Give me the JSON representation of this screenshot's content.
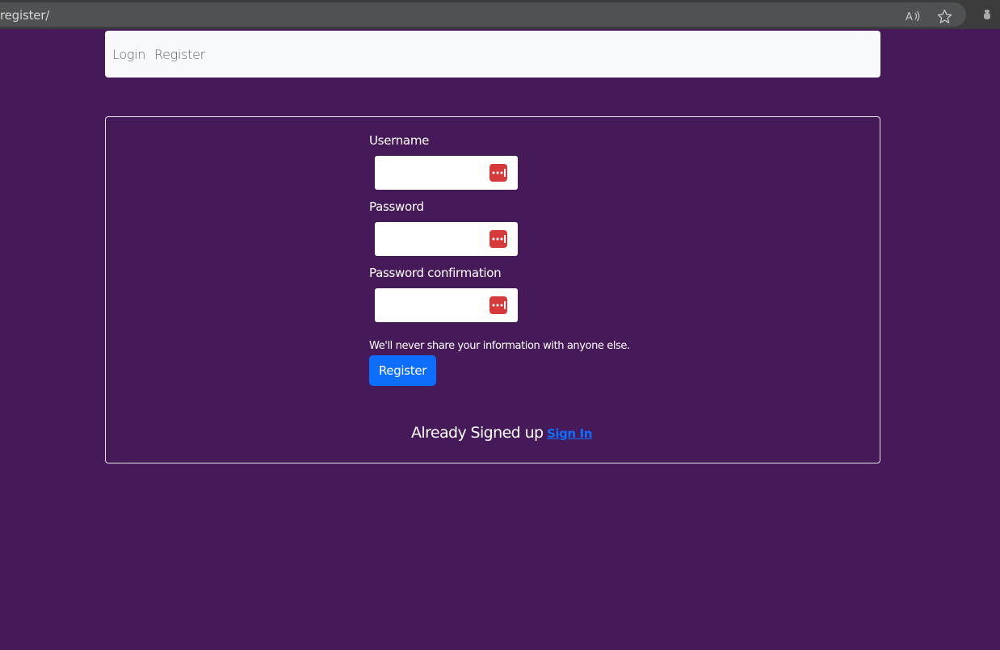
{
  "browser": {
    "url": "register/",
    "icons": [
      "read-aloud-icon",
      "favorite-star-icon",
      "extension-icon"
    ]
  },
  "navbar": {
    "login_label": "Login",
    "register_label": "Register"
  },
  "form": {
    "username_label": "Username",
    "username_value": "",
    "password_label": "Password",
    "password_value": "",
    "password_confirm_label": "Password confirmation",
    "password_confirm_value": "",
    "password_manager_icon": "password-manager-icon",
    "help_text": "We'll never share your information with anyone else.",
    "submit_label": "Register"
  },
  "footer": {
    "signed_up_text": "Already Signed up",
    "signin_link": "Sign In"
  },
  "colors": {
    "background": "#461a58",
    "navbar": "#f8f9fa",
    "primary": "#0d6efd",
    "password_manager": "#d63b3b"
  }
}
